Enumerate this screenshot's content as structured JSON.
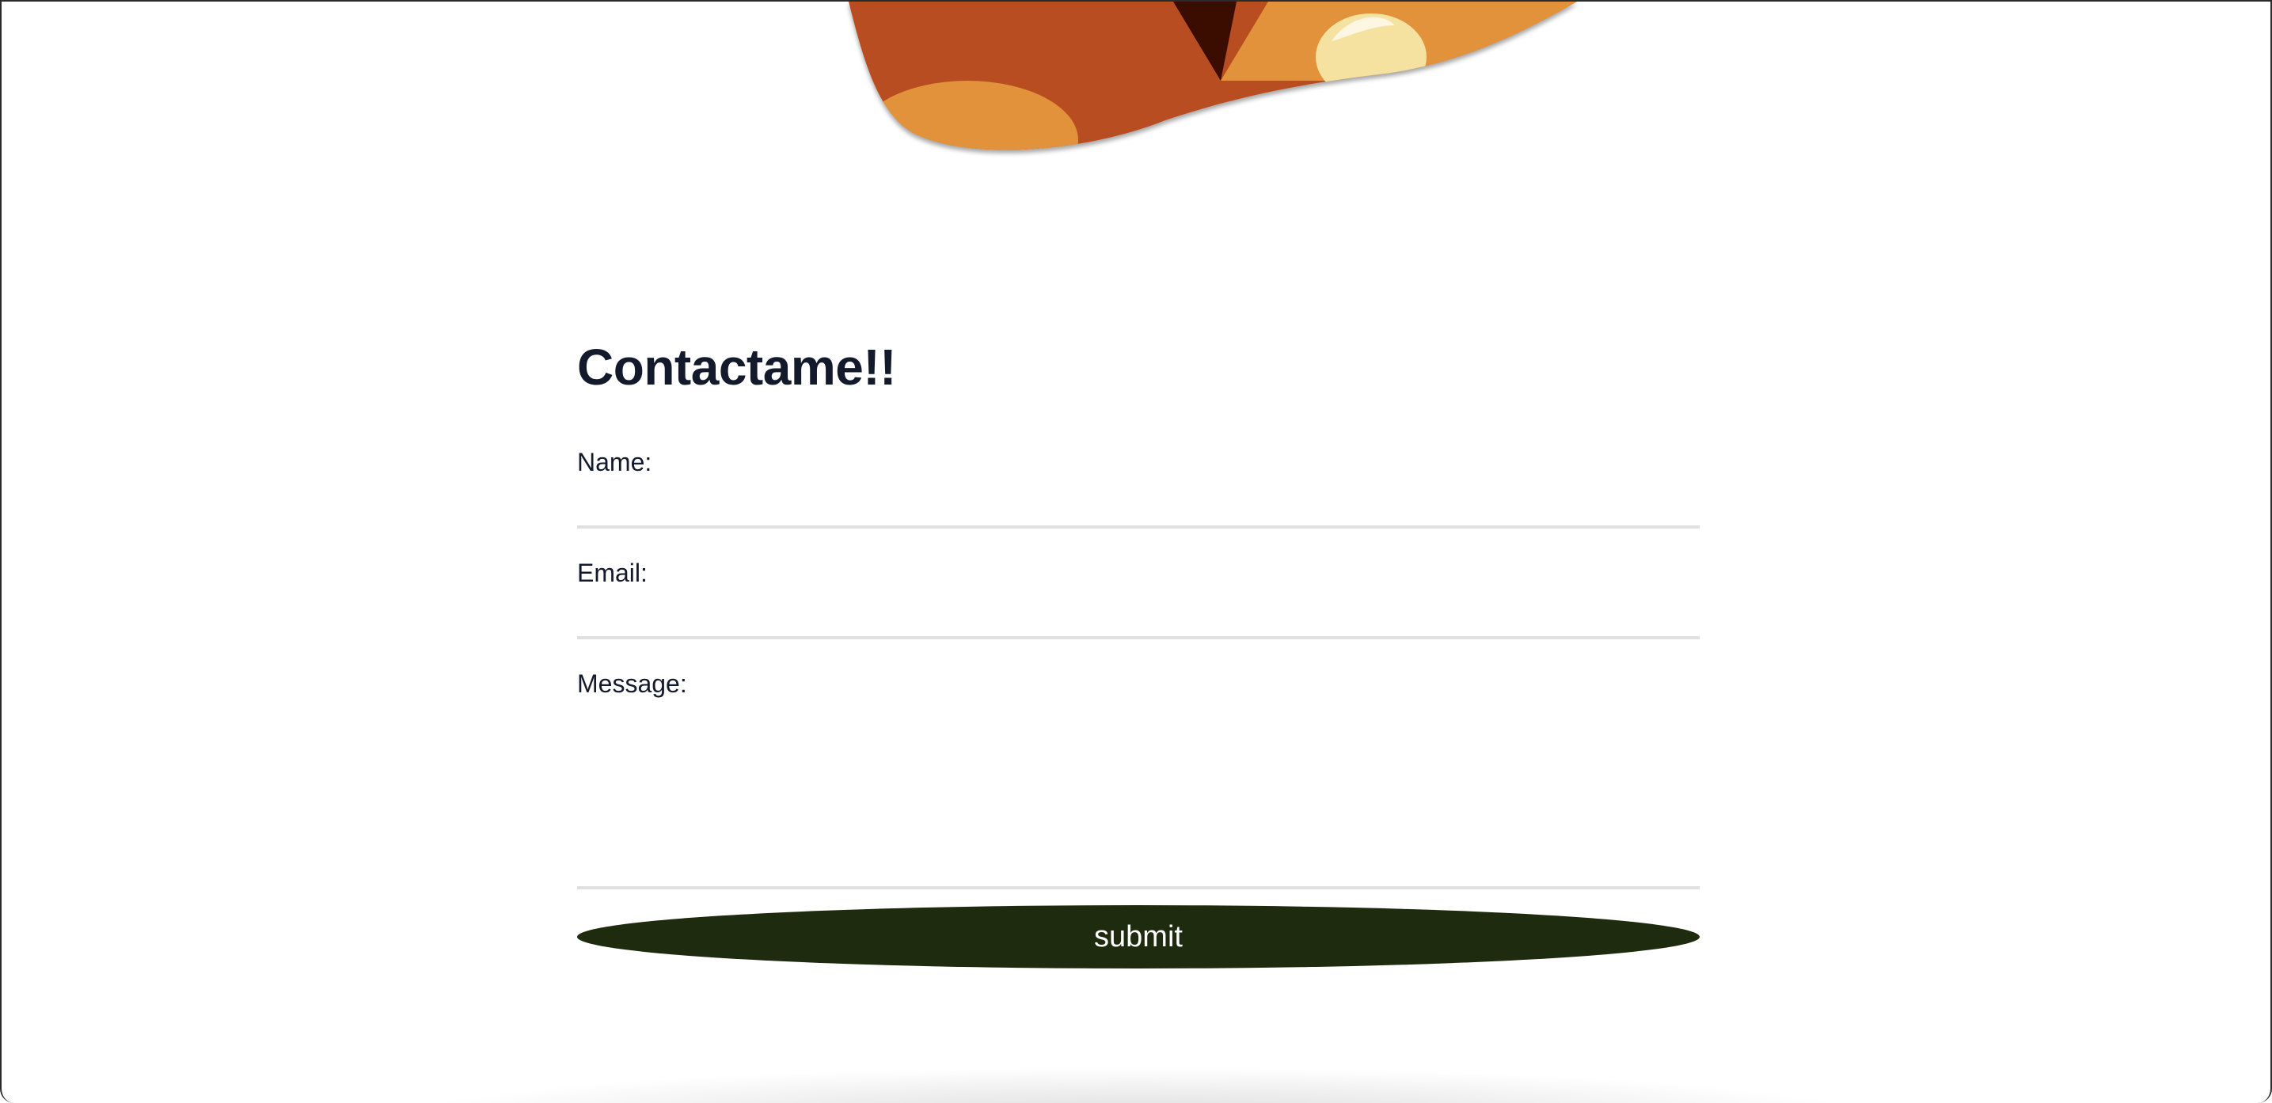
{
  "contact": {
    "title": "Contactame!!",
    "name_label": "Name:",
    "name_value": "",
    "email_label": "Email:",
    "email_value": "",
    "message_label": "Message:",
    "message_value": "",
    "submit_label": "submit"
  },
  "colors": {
    "heading": "#131a2b",
    "submit_bg": "#1f2b0f",
    "submit_text": "#ffffff",
    "field_underline": "#e0e0e0",
    "art_orange": "#b84e24",
    "art_amber": "#e2923a",
    "art_dark": "#3a1005",
    "art_cream": "#f5e2a0"
  }
}
